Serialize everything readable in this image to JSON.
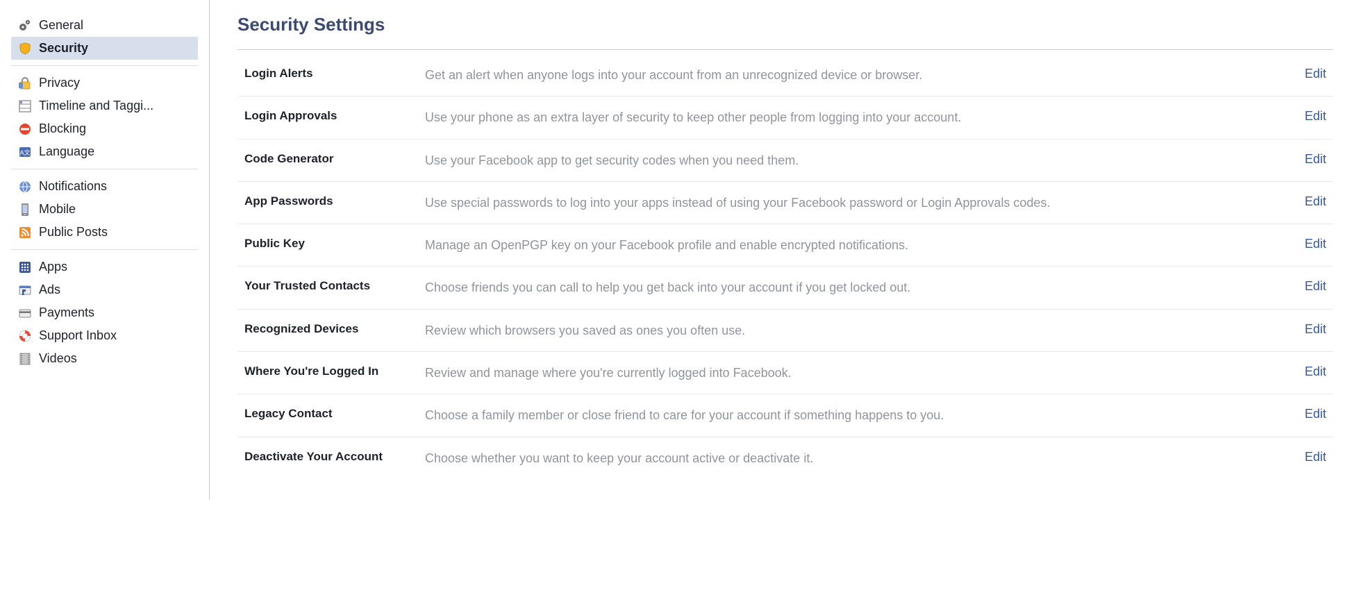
{
  "page_title": "Security Settings",
  "edit_label": "Edit",
  "sidebar": {
    "groups": [
      {
        "items": [
          {
            "id": "general",
            "label": "General",
            "icon": "gears-icon",
            "active": false
          },
          {
            "id": "security",
            "label": "Security",
            "icon": "shield-icon",
            "active": true
          }
        ]
      },
      {
        "items": [
          {
            "id": "privacy",
            "label": "Privacy",
            "icon": "lock-icon",
            "active": false
          },
          {
            "id": "timeline",
            "label": "Timeline and Taggi...",
            "icon": "timeline-icon",
            "active": false
          },
          {
            "id": "blocking",
            "label": "Blocking",
            "icon": "blocking-icon",
            "active": false
          },
          {
            "id": "language",
            "label": "Language",
            "icon": "language-icon",
            "active": false
          }
        ]
      },
      {
        "items": [
          {
            "id": "notifications",
            "label": "Notifications",
            "icon": "globe-icon",
            "active": false
          },
          {
            "id": "mobile",
            "label": "Mobile",
            "icon": "mobile-icon",
            "active": false
          },
          {
            "id": "publicposts",
            "label": "Public Posts",
            "icon": "rss-icon",
            "active": false
          }
        ]
      },
      {
        "items": [
          {
            "id": "apps",
            "label": "Apps",
            "icon": "apps-icon",
            "active": false
          },
          {
            "id": "ads",
            "label": "Ads",
            "icon": "ads-icon",
            "active": false
          },
          {
            "id": "payments",
            "label": "Payments",
            "icon": "card-icon",
            "active": false
          },
          {
            "id": "support",
            "label": "Support Inbox",
            "icon": "lifebuoy-icon",
            "active": false
          },
          {
            "id": "videos",
            "label": "Videos",
            "icon": "film-icon",
            "active": false
          }
        ]
      }
    ]
  },
  "settings": [
    {
      "id": "login-alerts",
      "label": "Login Alerts",
      "desc": "Get an alert when anyone logs into your account from an unrecognized device or browser."
    },
    {
      "id": "login-approvals",
      "label": "Login Approvals",
      "desc": "Use your phone as an extra layer of security to keep other people from logging into your account."
    },
    {
      "id": "code-generator",
      "label": "Code Generator",
      "desc": "Use your Facebook app to get security codes when you need them."
    },
    {
      "id": "app-passwords",
      "label": "App Passwords",
      "desc": "Use special passwords to log into your apps instead of using your Facebook password or Login Approvals codes."
    },
    {
      "id": "public-key",
      "label": "Public Key",
      "desc": "Manage an OpenPGP key on your Facebook profile and enable encrypted notifications."
    },
    {
      "id": "trusted-contacts",
      "label": "Your Trusted Contacts",
      "desc": "Choose friends you can call to help you get back into your account if you get locked out."
    },
    {
      "id": "recognized-devices",
      "label": "Recognized Devices",
      "desc": "Review which browsers you saved as ones you often use."
    },
    {
      "id": "where-logged-in",
      "label": "Where You're Logged In",
      "desc": "Review and manage where you're currently logged into Facebook."
    },
    {
      "id": "legacy-contact",
      "label": "Legacy Contact",
      "desc": "Choose a family member or close friend to care for your account if something happens to you."
    },
    {
      "id": "deactivate",
      "label": "Deactivate Your Account",
      "desc": "Choose whether you want to keep your account active or deactivate it."
    }
  ]
}
